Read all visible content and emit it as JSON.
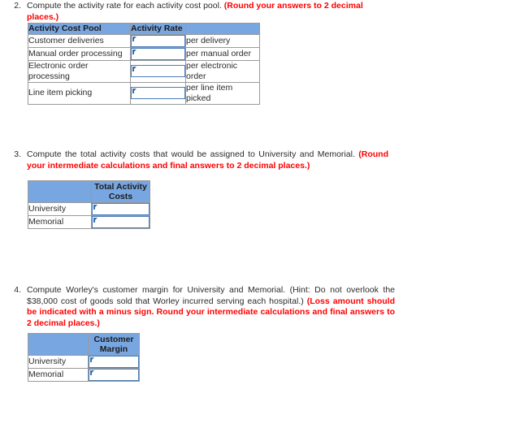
{
  "colors": {
    "header_fill": "#78a6e0",
    "input_border": "#4a7ebb",
    "grid_border": "#9a9a9a",
    "instruction_red": "#ff0000",
    "body_text": "#2b2b2b"
  },
  "questions": [
    {
      "number": "2.",
      "text_plain": "Compute the activity rate for each activity cost pool. ",
      "text_red": "(Round your answers to 2 decimal places.)"
    },
    {
      "number": "3.",
      "text_plain": "Compute the total activity costs that would be assigned to University and Memorial. ",
      "text_red": "(Round your intermediate calculations and final answers to 2 decimal places.)"
    },
    {
      "number": "4.",
      "text_plain": "Compute Worley's customer margin for University and Memorial. (Hint: Do not overlook the $38,000 cost of goods sold that Worley incurred serving each hospital.) ",
      "text_red": "(Loss amount should be indicated with a minus sign. Round your intermediate calculations and final answers to 2 decimal places.)"
    }
  ],
  "activity_rate_table": {
    "headers": [
      "Activity Cost Pool",
      "Activity Rate",
      ""
    ],
    "rows": [
      {
        "pool": "Customer deliveries",
        "rate_value": "",
        "unit": "per delivery"
      },
      {
        "pool": "Manual order processing",
        "rate_value": "",
        "unit": "per manual order"
      },
      {
        "pool": "Electronic order processing",
        "rate_value": "",
        "unit": "per electronic order"
      },
      {
        "pool": "Line item picking",
        "rate_value": "",
        "unit": "per line item picked"
      }
    ]
  },
  "total_activity_costs_table": {
    "headers": [
      "",
      "Total Activity Costs"
    ],
    "rows": [
      {
        "customer": "University",
        "value": ""
      },
      {
        "customer": "Memorial",
        "value": ""
      }
    ]
  },
  "customer_margin_table": {
    "headers": [
      "",
      "Customer Margin"
    ],
    "rows": [
      {
        "customer": "University",
        "value": ""
      },
      {
        "customer": "Memorial",
        "value": ""
      }
    ]
  }
}
